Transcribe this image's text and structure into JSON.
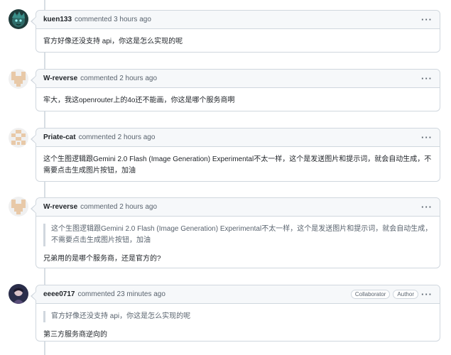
{
  "comments": [
    {
      "author": "kuen133",
      "verb": "commented",
      "time": "3 hours ago",
      "menu": "···",
      "quote": "",
      "text": "官方好像还没支持 api，你这是怎么实现的呢",
      "avatar": "anime-avatar"
    },
    {
      "author": "W-reverse",
      "verb": "commented",
      "time": "2 hours ago",
      "menu": "···",
      "quote": "",
      "text": "牢大，我这openrouter上的4o还不能画，你这是哪个服务商啊",
      "avatar": "identicon-avatar"
    },
    {
      "author": "Priate-cat",
      "verb": "commented",
      "time": "2 hours ago",
      "menu": "···",
      "quote": "",
      "text": "这个生图逻辑跟Gemini 2.0 Flash (Image Generation) Experimental不太一样，这个是发送图片和提示词，就会自动生成，不需要点击生成图片按钮，加油",
      "avatar": "identicon-avatar"
    },
    {
      "author": "W-reverse",
      "verb": "commented",
      "time": "2 hours ago",
      "menu": "···",
      "quote": "这个生图逻辑跟Gemini 2.0 Flash (Image Generation) Experimental不太一样，这个是发送图片和提示词，就会自动生成，不需要点击生成图片按钮，加油",
      "text": "兄弟用的是哪个服务商，还是官方的?",
      "avatar": "identicon-avatar"
    },
    {
      "author": "eeee0717",
      "verb": "commented",
      "time": "23 minutes ago",
      "menu": "···",
      "badges": [
        "Collaborator",
        "Author"
      ],
      "quote": "官方好像还没支持 api，你这是怎么实现的呢",
      "text": "第三方服务商逆向的",
      "avatar": "photo-avatar"
    }
  ],
  "colors": {
    "identicon": "#e8c9a8",
    "border": "#d0d7de",
    "header_bg": "#f6f8fa"
  }
}
